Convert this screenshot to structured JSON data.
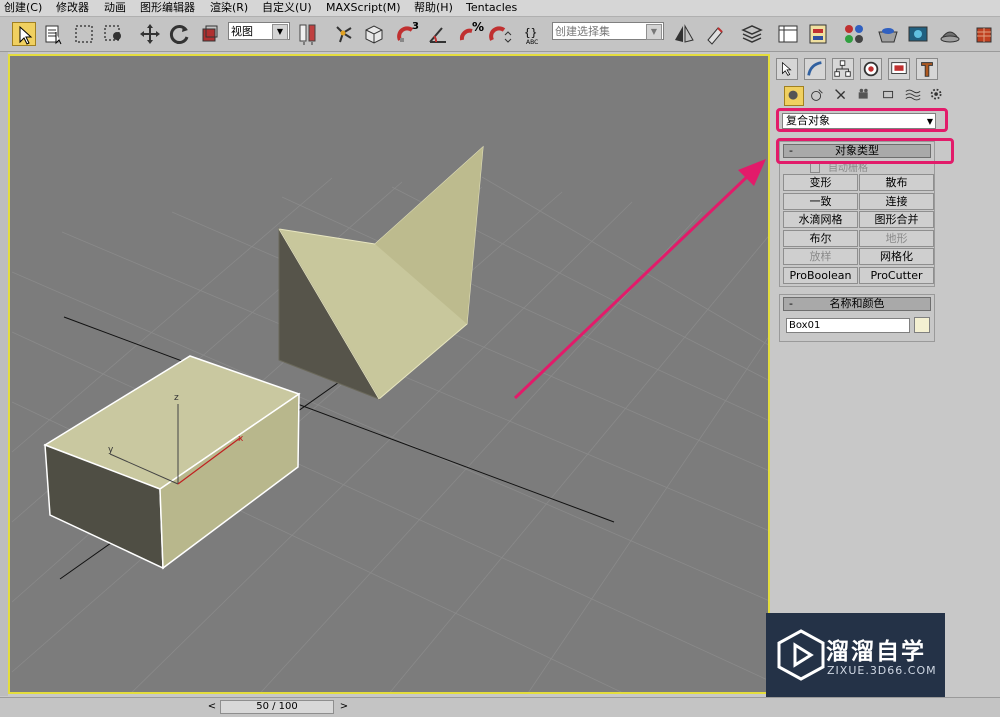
{
  "menu": [
    "创建(C)",
    "修改器",
    "动画",
    "图形编辑器",
    "渲染(R)",
    "自定义(U)",
    "MAXScript(M)",
    "帮助(H)",
    "Tentacles"
  ],
  "toolbar": {
    "view_dropdown": "视图",
    "selection_set_placeholder": "创建选择集",
    "snap_label": "3",
    "angle_snap_label": "%"
  },
  "command_panel": {
    "category": "复合对象",
    "object_type": {
      "title": "对象类型",
      "auto_grid": "自动栅格",
      "buttons": [
        {
          "label": "变形",
          "enabled": true
        },
        {
          "label": "散布",
          "enabled": true
        },
        {
          "label": "一致",
          "enabled": true
        },
        {
          "label": "连接",
          "enabled": true
        },
        {
          "label": "水滴网格",
          "enabled": true
        },
        {
          "label": "图形合并",
          "enabled": true
        },
        {
          "label": "布尔",
          "enabled": true
        },
        {
          "label": "地形",
          "enabled": false
        },
        {
          "label": "放样",
          "enabled": false
        },
        {
          "label": "网格化",
          "enabled": true
        },
        {
          "label": "ProBoolean",
          "enabled": true
        },
        {
          "label": "ProCutter",
          "enabled": true
        }
      ]
    },
    "name_color": {
      "title": "名称和颜色",
      "name_value": "Box01",
      "color": "#f4f0d2"
    }
  },
  "viewport": {
    "axis_labels": {
      "z": "z",
      "y": "y",
      "x": "x"
    },
    "background": "#7c7c7c",
    "border_color": "#e4dd3c"
  },
  "timeline": {
    "frame": "50 / 100"
  },
  "watermark": {
    "title": "溜溜自学",
    "subtitle": "ZIXUE.3D66.COM"
  },
  "highlight_color": "#e21b6a"
}
